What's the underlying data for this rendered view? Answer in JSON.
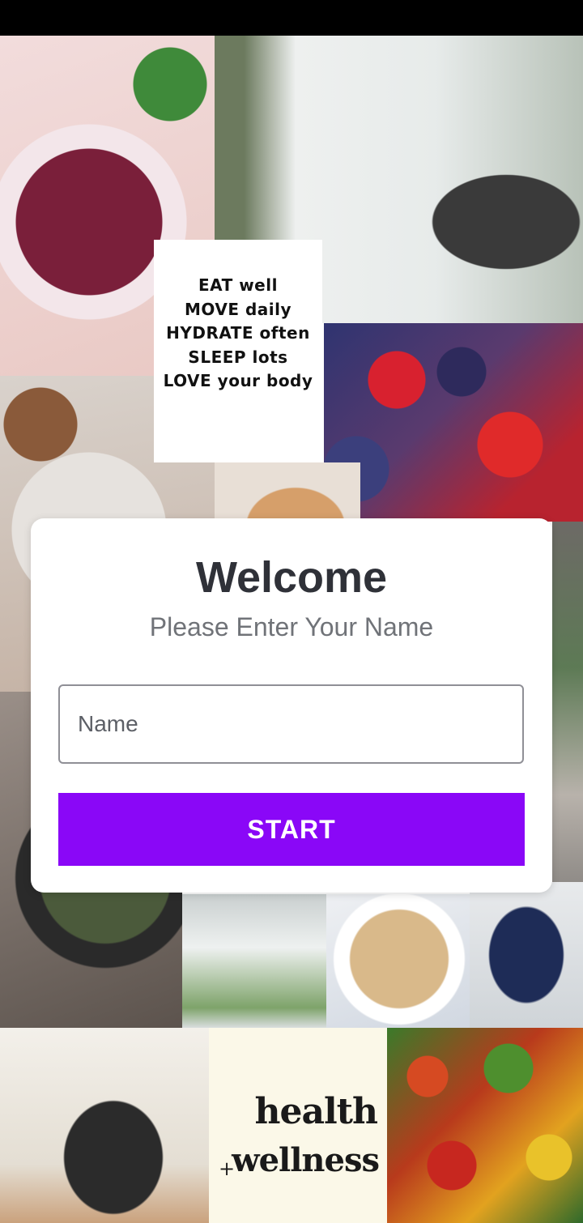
{
  "collage": {
    "motto_lines": [
      "EAT well",
      "MOVE daily",
      "HYDRATE often",
      "SLEEP lots",
      "LOVE your body"
    ],
    "brand_health": "health",
    "brand_plus": "+",
    "brand_wellness": "wellness"
  },
  "welcome": {
    "title": "Welcome",
    "subtitle": "Please Enter Your Name",
    "name_placeholder": "Name",
    "name_value": "",
    "start_label": "START"
  },
  "colors": {
    "accent": "#8a07f7",
    "title": "#2f3138",
    "subtitle": "#707378"
  }
}
